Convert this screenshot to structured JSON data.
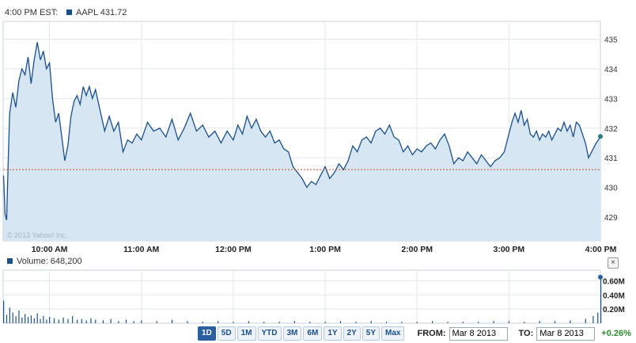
{
  "header": {
    "time_label": "4:00 PM EST:",
    "symbol_label": "AAPL 431.72",
    "legend_color": "#1b4f8a"
  },
  "copyright": "© 2013 Yahoo! Inc.",
  "volume": {
    "label": "Volume: 648,200",
    "ticks": [
      "0.60M",
      "0.40M",
      "0.20M"
    ]
  },
  "controls": {
    "ranges": [
      "1D",
      "5D",
      "1M",
      "YTD",
      "3M",
      "6M",
      "1Y",
      "2Y",
      "5Y",
      "Max"
    ],
    "active_range": "1D",
    "from_label": "FROM:",
    "from_value": "Mar 8 2013",
    "to_label": "TO:",
    "to_value": "Mar 8 2013",
    "change": "+0.26%",
    "change_color": "#2e8b2e",
    "close_symbol": "×"
  },
  "chart_data": [
    {
      "type": "area",
      "x_type": "time",
      "xtick_labels": [
        "10:00 AM",
        "11:00 AM",
        "12:00 PM",
        "1:00 PM",
        "2:00 PM",
        "3:00 PM",
        "4:00 PM"
      ],
      "ytick_labels": [
        "429",
        "430",
        "431",
        "432",
        "433",
        "434",
        "435"
      ],
      "ylim": [
        428.2,
        435.6
      ],
      "grid": true,
      "line_color": "#1b4f8a",
      "fill_color": "#d6e6f3",
      "previous_close": 430.6,
      "previous_close_color": "#d24c2b",
      "last_value": 431.72,
      "series": [
        {
          "name": "AAPL",
          "points": [
            [
              "9:30",
              430.4
            ],
            [
              "9:31",
              429.1
            ],
            [
              "9:32",
              428.9
            ],
            [
              "9:33",
              430.8
            ],
            [
              "9:34",
              432.5
            ],
            [
              "9:36",
              433.2
            ],
            [
              "9:38",
              432.7
            ],
            [
              "9:40",
              433.6
            ],
            [
              "9:42",
              434.0
            ],
            [
              "9:44",
              433.8
            ],
            [
              "9:46",
              434.4
            ],
            [
              "9:48",
              433.5
            ],
            [
              "9:50",
              434.3
            ],
            [
              "9:52",
              434.9
            ],
            [
              "9:54",
              434.3
            ],
            [
              "9:56",
              434.6
            ],
            [
              "9:58",
              434.0
            ],
            [
              "10:00",
              434.2
            ],
            [
              "10:02",
              433.0
            ],
            [
              "10:04",
              432.2
            ],
            [
              "10:06",
              432.5
            ],
            [
              "10:08",
              431.7
            ],
            [
              "10:10",
              430.9
            ],
            [
              "10:12",
              431.4
            ],
            [
              "10:14",
              432.4
            ],
            [
              "10:16",
              432.9
            ],
            [
              "10:18",
              433.1
            ],
            [
              "10:20",
              432.8
            ],
            [
              "10:22",
              433.4
            ],
            [
              "10:24",
              433.1
            ],
            [
              "10:26",
              433.4
            ],
            [
              "10:28",
              433.0
            ],
            [
              "10:30",
              433.3
            ],
            [
              "10:33",
              432.6
            ],
            [
              "10:36",
              431.9
            ],
            [
              "10:39",
              432.4
            ],
            [
              "10:42",
              431.9
            ],
            [
              "10:45",
              432.2
            ],
            [
              "10:48",
              431.2
            ],
            [
              "10:51",
              431.6
            ],
            [
              "10:54",
              431.5
            ],
            [
              "10:57",
              431.8
            ],
            [
              "11:00",
              431.6
            ],
            [
              "11:04",
              432.2
            ],
            [
              "11:08",
              431.9
            ],
            [
              "11:12",
              432.0
            ],
            [
              "11:16",
              431.7
            ],
            [
              "11:20",
              432.3
            ],
            [
              "11:24",
              431.6
            ],
            [
              "11:28",
              432.0
            ],
            [
              "11:32",
              432.5
            ],
            [
              "11:36",
              431.9
            ],
            [
              "11:40",
              432.1
            ],
            [
              "11:44",
              431.7
            ],
            [
              "11:48",
              431.9
            ],
            [
              "11:52",
              431.5
            ],
            [
              "11:56",
              431.9
            ],
            [
              "12:00",
              431.6
            ],
            [
              "12:03",
              432.1
            ],
            [
              "12:06",
              431.8
            ],
            [
              "12:09",
              432.4
            ],
            [
              "12:12",
              432.0
            ],
            [
              "12:15",
              432.3
            ],
            [
              "12:18",
              431.9
            ],
            [
              "12:21",
              431.7
            ],
            [
              "12:24",
              431.9
            ],
            [
              "12:27",
              431.5
            ],
            [
              "12:30",
              431.6
            ],
            [
              "12:33",
              431.3
            ],
            [
              "12:36",
              431.2
            ],
            [
              "12:39",
              430.7
            ],
            [
              "12:42",
              430.5
            ],
            [
              "12:45",
              430.3
            ],
            [
              "12:48",
              430.0
            ],
            [
              "12:51",
              430.2
            ],
            [
              "12:54",
              430.1
            ],
            [
              "12:57",
              430.4
            ],
            [
              "13:00",
              430.7
            ],
            [
              "13:03",
              430.3
            ],
            [
              "13:06",
              430.5
            ],
            [
              "13:09",
              430.8
            ],
            [
              "13:12",
              430.6
            ],
            [
              "13:15",
              430.9
            ],
            [
              "13:18",
              431.4
            ],
            [
              "13:21",
              431.2
            ],
            [
              "13:24",
              431.6
            ],
            [
              "13:27",
              431.7
            ],
            [
              "13:30",
              431.5
            ],
            [
              "13:33",
              431.9
            ],
            [
              "13:36",
              432.0
            ],
            [
              "13:39",
              431.8
            ],
            [
              "13:42",
              432.1
            ],
            [
              "13:45",
              431.7
            ],
            [
              "13:48",
              431.6
            ],
            [
              "13:51",
              431.2
            ],
            [
              "13:54",
              431.4
            ],
            [
              "13:57",
              431.1
            ],
            [
              "14:00",
              431.3
            ],
            [
              "14:03",
              431.2
            ],
            [
              "14:06",
              431.4
            ],
            [
              "14:09",
              431.5
            ],
            [
              "14:12",
              431.3
            ],
            [
              "14:15",
              431.6
            ],
            [
              "14:18",
              431.8
            ],
            [
              "14:21",
              431.4
            ],
            [
              "14:24",
              430.8
            ],
            [
              "14:27",
              431.0
            ],
            [
              "14:30",
              430.9
            ],
            [
              "14:33",
              431.2
            ],
            [
              "14:36",
              431.0
            ],
            [
              "14:39",
              430.8
            ],
            [
              "14:42",
              431.1
            ],
            [
              "14:45",
              430.9
            ],
            [
              "14:48",
              430.7
            ],
            [
              "14:51",
              430.9
            ],
            [
              "14:54",
              431.0
            ],
            [
              "14:57",
              431.2
            ],
            [
              "15:00",
              431.8
            ],
            [
              "15:02",
              432.2
            ],
            [
              "15:04",
              432.5
            ],
            [
              "15:06",
              432.2
            ],
            [
              "15:08",
              432.6
            ],
            [
              "15:10",
              432.1
            ],
            [
              "15:12",
              432.3
            ],
            [
              "15:14",
              431.8
            ],
            [
              "15:16",
              431.7
            ],
            [
              "15:18",
              431.9
            ],
            [
              "15:20",
              431.6
            ],
            [
              "15:22",
              431.8
            ],
            [
              "15:24",
              431.7
            ],
            [
              "15:26",
              431.9
            ],
            [
              "15:28",
              431.6
            ],
            [
              "15:30",
              431.8
            ],
            [
              "15:32",
              432.0
            ],
            [
              "15:34",
              431.9
            ],
            [
              "15:36",
              432.2
            ],
            [
              "15:38",
              431.9
            ],
            [
              "15:40",
              432.1
            ],
            [
              "15:42",
              431.7
            ],
            [
              "15:44",
              432.2
            ],
            [
              "15:46",
              432.1
            ],
            [
              "15:48",
              431.8
            ],
            [
              "15:50",
              431.5
            ],
            [
              "15:52",
              431.0
            ],
            [
              "15:54",
              431.2
            ],
            [
              "15:57",
              431.5
            ],
            [
              "16:00",
              431.72
            ]
          ]
        }
      ]
    },
    {
      "type": "bar",
      "x_type": "time",
      "series_name": "Volume",
      "ylim": [
        0,
        0.75
      ],
      "unit": "M",
      "bar_color": "#1b4f8a",
      "values": [
        [
          "9:30",
          0.32
        ],
        [
          "9:32",
          0.12
        ],
        [
          "9:34",
          0.22
        ],
        [
          "9:36",
          0.15
        ],
        [
          "9:38",
          0.1
        ],
        [
          "9:40",
          0.18
        ],
        [
          "9:42",
          0.08
        ],
        [
          "9:44",
          0.13
        ],
        [
          "9:46",
          0.09
        ],
        [
          "9:48",
          0.11
        ],
        [
          "9:50",
          0.07
        ],
        [
          "9:52",
          0.14
        ],
        [
          "9:54",
          0.06
        ],
        [
          "9:56",
          0.1
        ],
        [
          "9:58",
          0.05
        ],
        [
          "10:00",
          0.09
        ],
        [
          "10:03",
          0.07
        ],
        [
          "10:06",
          0.05
        ],
        [
          "10:09",
          0.08
        ],
        [
          "10:12",
          0.06
        ],
        [
          "10:15",
          0.1
        ],
        [
          "10:18",
          0.05
        ],
        [
          "10:21",
          0.06
        ],
        [
          "10:24",
          0.04
        ],
        [
          "10:27",
          0.07
        ],
        [
          "10:30",
          0.05
        ],
        [
          "10:35",
          0.04
        ],
        [
          "10:40",
          0.06
        ],
        [
          "10:45",
          0.03
        ],
        [
          "10:50",
          0.05
        ],
        [
          "10:55",
          0.03
        ],
        [
          "11:00",
          0.04
        ],
        [
          "11:10",
          0.03
        ],
        [
          "11:20",
          0.05
        ],
        [
          "11:30",
          0.03
        ],
        [
          "11:40",
          0.02
        ],
        [
          "11:50",
          0.03
        ],
        [
          "12:00",
          0.02
        ],
        [
          "12:10",
          0.03
        ],
        [
          "12:20",
          0.02
        ],
        [
          "12:30",
          0.02
        ],
        [
          "12:40",
          0.03
        ],
        [
          "12:50",
          0.02
        ],
        [
          "13:00",
          0.02
        ],
        [
          "13:10",
          0.03
        ],
        [
          "13:20",
          0.02
        ],
        [
          "13:30",
          0.03
        ],
        [
          "13:40",
          0.02
        ],
        [
          "13:50",
          0.02
        ],
        [
          "14:00",
          0.02
        ],
        [
          "14:10",
          0.03
        ],
        [
          "14:20",
          0.02
        ],
        [
          "14:30",
          0.02
        ],
        [
          "14:40",
          0.02
        ],
        [
          "14:50",
          0.03
        ],
        [
          "15:00",
          0.03
        ],
        [
          "15:10",
          0.02
        ],
        [
          "15:20",
          0.03
        ],
        [
          "15:30",
          0.03
        ],
        [
          "15:40",
          0.04
        ],
        [
          "15:50",
          0.06
        ],
        [
          "15:55",
          0.1
        ],
        [
          "15:58",
          0.15
        ],
        [
          "16:00",
          0.65
        ]
      ]
    }
  ]
}
